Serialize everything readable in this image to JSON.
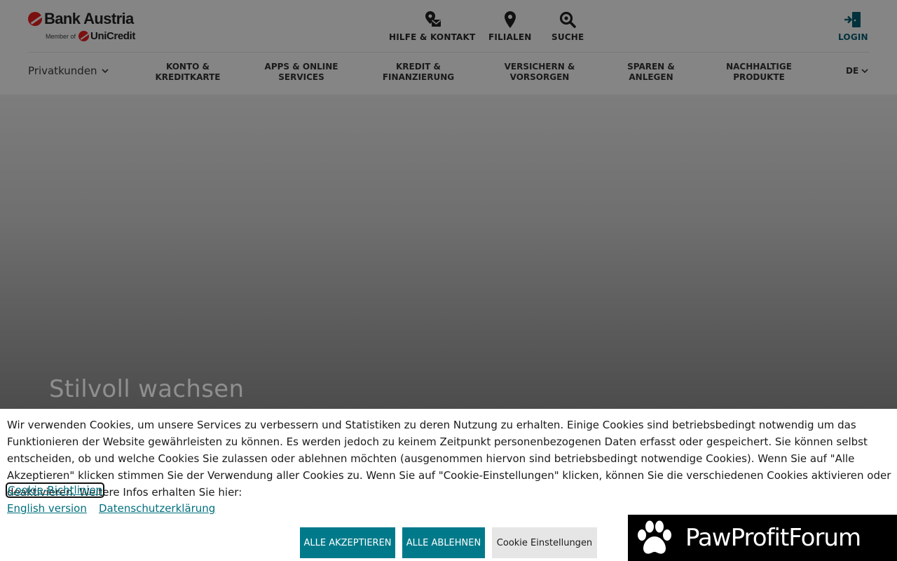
{
  "brand": {
    "name": "Bank Austria",
    "member_of": "Member of",
    "parent": "UniCredit"
  },
  "top_links": {
    "help": "HILFE & KONTAKT",
    "branches": "FILIALEN",
    "search": "SUCHE",
    "login": "LOGIN"
  },
  "segment": "Privatkunden",
  "nav": [
    "KONTO &\nKREDITKARTE",
    "APPS & ONLINE\nSERVICES",
    "KREDIT &\nFINANZIERUNG",
    "VERSICHERN &\nVORSORGEN",
    "SPAREN &\nANLEGEN",
    "NACHHALTIGE\nPRODUKTE"
  ],
  "language": "DE",
  "hero": {
    "title": "Stilvoll wachsen"
  },
  "cookie": {
    "text": "Wir verwenden Cookies, um unsere Services zu verbessern und Statistiken zu deren Nutzung zu erhalten. Einige Cookies sind betriebsbedingt notwendig um das Funktionieren der Website gewährleisten zu können. Es werden jedoch zu keinem Zeitpunkt personenbezogenen Daten erfasst oder gespeichert. Sie können selbst entscheiden, ob und welche Cookies Sie zulassen oder ablehnen möchten (ausgenommen hiervon sind betriebsbedingt notwendige Cookies). Wenn Sie auf \"Alle Akzeptieren\" klicken stimmen Sie der Verwendung aller Cookies zu. Wenn Sie auf \"Cookie-Einstellungen\" klicken, können Sie die verschiedenen Cookies aktivieren oder deaktivieren. Weitere Infos erhalten Sie hier:",
    "policy_link": "Cookie-Richtlinien",
    "english_link": "English version",
    "privacy_link": "Datenschutzerklärung",
    "accept_all": "ALLE AKZEPTIEREN",
    "reject_all": "ALLE ABLEHNEN",
    "settings": "Cookie Einstellungen"
  },
  "watermark": {
    "text": "PawProfitForum"
  },
  "colors": {
    "accent": "#007a8a",
    "brand_red": "#7a1010",
    "overlay_header": "#858585"
  }
}
